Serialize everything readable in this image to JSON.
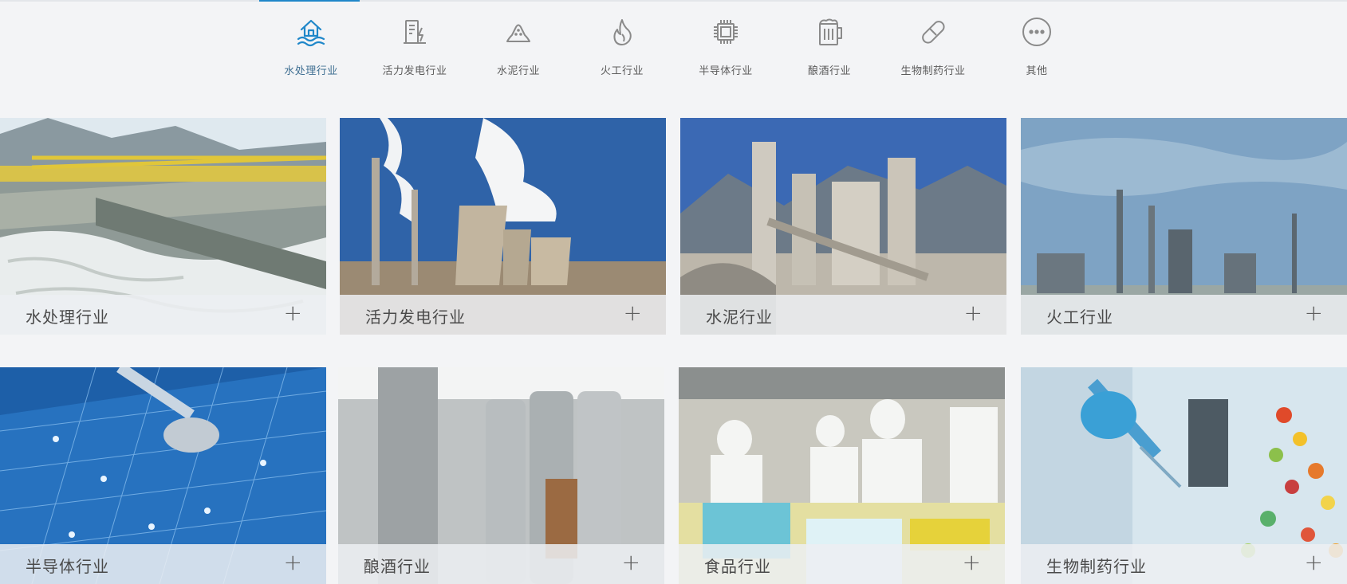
{
  "nav": {
    "tabs": [
      {
        "label": "水处理行业",
        "icon": "water-house-icon",
        "active": true
      },
      {
        "label": "活力发电行业",
        "icon": "power-plant-icon",
        "active": false
      },
      {
        "label": "水泥行业",
        "icon": "cement-pile-icon",
        "active": false
      },
      {
        "label": "火工行业",
        "icon": "flame-icon",
        "active": false
      },
      {
        "label": "半导体行业",
        "icon": "chip-icon",
        "active": false
      },
      {
        "label": "酿酒行业",
        "icon": "beer-mug-icon",
        "active": false
      },
      {
        "label": "生物制药行业",
        "icon": "capsule-icon",
        "active": false
      },
      {
        "label": "其他",
        "icon": "more-dots-icon",
        "active": false
      }
    ]
  },
  "cards": [
    {
      "title": "水处理行业",
      "plus": "+",
      "image": "water-treatment-photo"
    },
    {
      "title": "活力发电行业",
      "plus": "+",
      "image": "power-plant-photo"
    },
    {
      "title": "水泥行业",
      "plus": "+",
      "image": "cement-plant-photo"
    },
    {
      "title": "火工行业",
      "plus": "+",
      "image": "refinery-photo"
    },
    {
      "title": "半导体行业",
      "plus": "+",
      "image": "semiconductor-photo"
    },
    {
      "title": "酿酒行业",
      "plus": "+",
      "image": "brewery-photo"
    },
    {
      "title": "食品行业",
      "plus": "+",
      "image": "food-factory-photo"
    },
    {
      "title": "生物制药行业",
      "plus": "+",
      "image": "biopharma-lab-photo"
    }
  ],
  "colors": {
    "accent": "#1f87c9",
    "background": "#f3f4f6",
    "icon_gray": "#8a8a8a"
  }
}
